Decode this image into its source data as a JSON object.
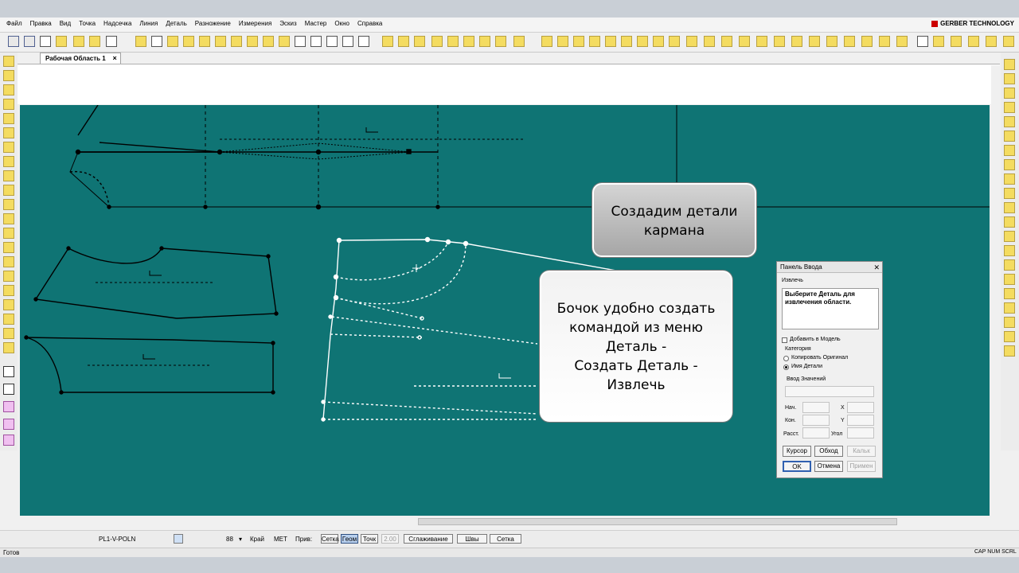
{
  "menu": [
    "Файл",
    "Правка",
    "Вид",
    "Точка",
    "Надсечка",
    "Линия",
    "Деталь",
    "Разножение",
    "Измерения",
    "Эскиз",
    "Мастер",
    "Окно",
    "Справка"
  ],
  "brand": "GERBER TECHNOLOGY",
  "workspace_tab": "Рабочая Область 1",
  "callout_top": {
    "line1": "Создадим детали",
    "line2": "кармана"
  },
  "callout_main": {
    "line1": "Бочок удобно создать",
    "line2": "командой из меню",
    "line3": "Деталь -",
    "line4": "Создать Деталь -",
    "line5": "Извлечь"
  },
  "panel": {
    "title": "Панель Ввода",
    "mode": "Извлечь",
    "message": "Выберите Деталь для извлечения области.",
    "add_to_model": "Добавить в Модель",
    "category_label": "Категория",
    "option_copy": "Копировать Оригинал",
    "option_names": "Имя Детали",
    "value_input_label": "Ввод Значений",
    "start_label": "Нач.",
    "end_label": "Кон.",
    "dist_label": "Расст.",
    "x_label": "X",
    "y_label": "Y",
    "angle_label": "Угол",
    "btn_cursor": "Курсор",
    "btn_trace": "Обход",
    "btn_kalk": "Кальк",
    "btn_ok": "OK",
    "btn_cancel": "Отмена",
    "btn_apply": "Примен"
  },
  "status": {
    "layer": "PL1-V-POLN",
    "zoom": "88",
    "krai": "Край",
    "units": "МЕТ",
    "priv": "Прив:",
    "btn_setka_short": "Сетка",
    "btn_geom": "Геом",
    "btn_tochk": "Точк",
    "step_value": "2.00",
    "btn_smooth": "Сглаживание",
    "btn_seams": "Швы",
    "btn_grid": "Сетка"
  },
  "bottom": {
    "ready": "Готов",
    "indicators": "CAP  NUM  SCRL"
  },
  "colors": {
    "canvas": "#0f7474",
    "callout_gray": "#b8b8b8",
    "accent_button": "#b8d0ef"
  }
}
